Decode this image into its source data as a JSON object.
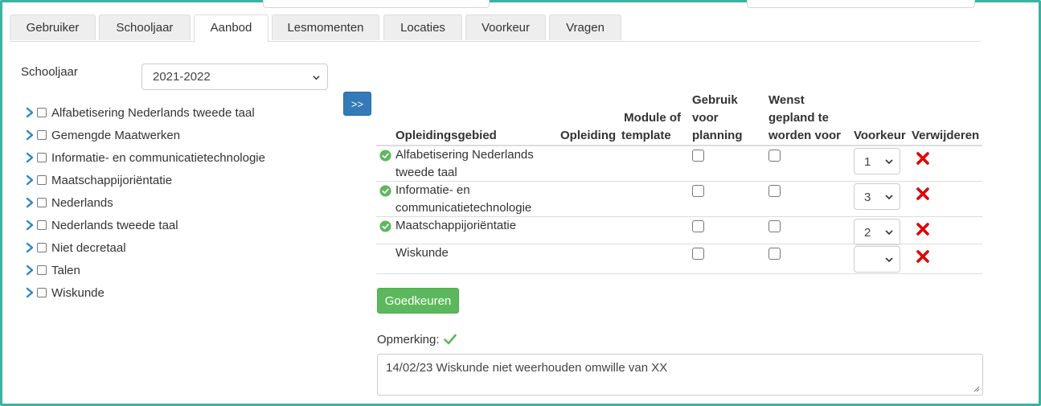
{
  "tabs": [
    "Gebruiker",
    "Schooljaar",
    "Aanbod",
    "Lesmomenten",
    "Locaties",
    "Voorkeur",
    "Vragen"
  ],
  "active_tab": "Aanbod",
  "schooljaar": {
    "label": "Schooljaar",
    "value": "2021-2022"
  },
  "tree": [
    "Alfabetisering Nederlands tweede taal",
    "Gemengde Maatwerken",
    "Informatie- en communicatietechnologie",
    "Maatschappijoriëntatie",
    "Nederlands",
    "Nederlands tweede taal",
    "Niet decretaal",
    "Talen",
    "Wiskunde"
  ],
  "move_button": ">>",
  "table": {
    "headers": {
      "opleidingsgebied": "Opleidingsgebied",
      "opleiding": "Opleiding",
      "module_line1": "Module of",
      "module_line2": "template",
      "gebruik_line1": "Gebruik",
      "gebruik_line2": "voor",
      "gebruik_line3": "planning",
      "wenst_line1": "Wenst",
      "wenst_line2": "gepland te",
      "wenst_line3": "worden voor",
      "voorkeur": "Voorkeur",
      "verwijderen": "Verwijderen"
    },
    "rows": [
      {
        "line1": "Alfabetisering Nederlands",
        "line2": "tweede taal",
        "approved": true,
        "gebruik": false,
        "wenst": false,
        "voorkeur": "1"
      },
      {
        "line1": "Informatie- en",
        "line2": "communicatietechnologie",
        "approved": true,
        "gebruik": false,
        "wenst": false,
        "voorkeur": "3"
      },
      {
        "line1": "Maatschappijoriëntatie",
        "line2": "",
        "approved": true,
        "gebruik": false,
        "wenst": false,
        "voorkeur": "2"
      },
      {
        "line1": "Wiskunde",
        "line2": "",
        "approved": false,
        "gebruik": false,
        "wenst": false,
        "voorkeur": ""
      }
    ]
  },
  "approve_button": "Goedkeuren",
  "remark": {
    "label": "Opmerking:",
    "value": "14/02/23 Wiskunde niet weerhouden omwille van XX"
  },
  "colors": {
    "accent_border": "#3bb3a0",
    "primary": "#337ab7",
    "success": "#5cb85c",
    "danger": "#e00000"
  }
}
